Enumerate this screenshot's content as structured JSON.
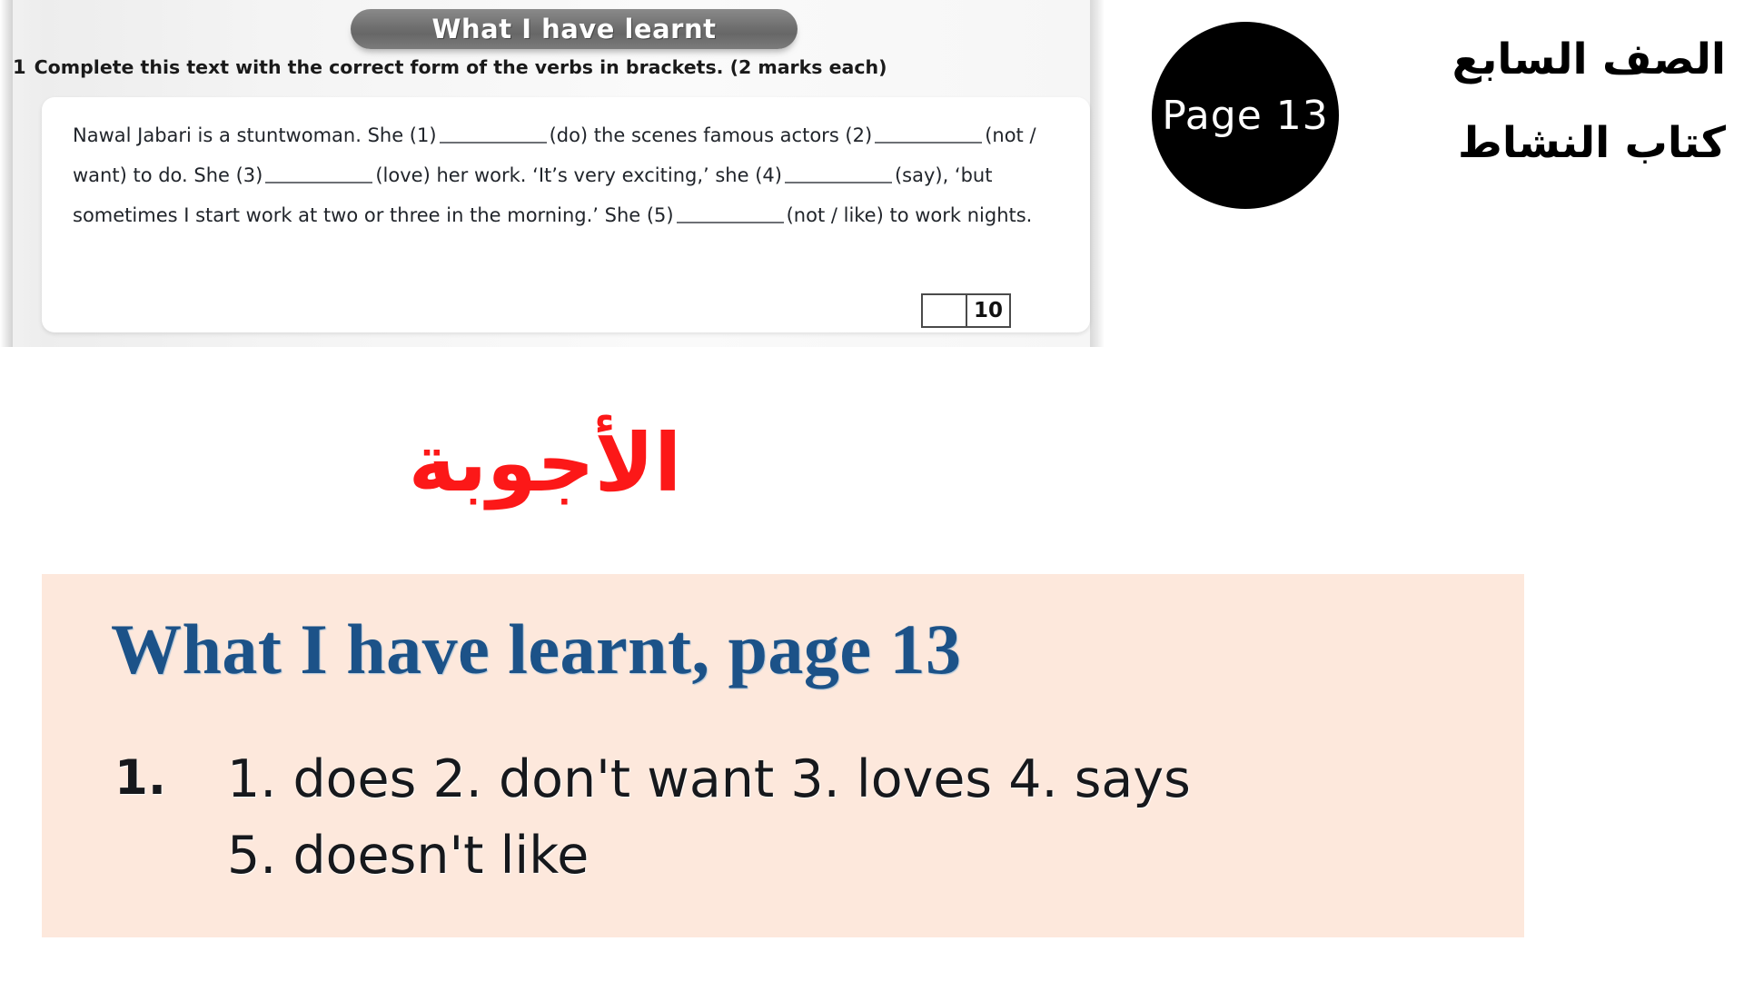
{
  "textbook": {
    "banner_label": "What I have learnt",
    "exercise_number": "1",
    "exercise_instruction": "Complete this text with the correct form of the verbs in brackets. (2 marks each)",
    "gapfill": {
      "seg1": "Nawal Jabari is a stuntwoman. She (1)",
      "seg2": "(do) the scenes famous actors (2)",
      "seg3": "(not / want) to do. She (3)",
      "seg4": "(love) her work. ‘It’s very exciting,’ she (4)",
      "seg5": "(say), ‘but sometimes I start work at two or three in the morning.’ She (5)",
      "seg6": "(not / like) to work nights."
    },
    "marks_total": "10"
  },
  "page_badge": {
    "label": "Page 13"
  },
  "arabic_header": {
    "line1": "الصف السابع",
    "line2": "كتاب النشاط"
  },
  "answers_title": {
    "label": "الأجوبة"
  },
  "answer_panel": {
    "heading": "What I have learnt, page 13",
    "item_number": "1.",
    "line1": "1. does  2. don't want  3. loves  4. says",
    "line2": "5. doesn't like"
  },
  "colors": {
    "answers_title_red": "#fc1818",
    "answer_panel_bg": "#fde8dc",
    "answer_heading_blue": "#1c5288",
    "page_badge_bg": "#000000",
    "banner_gray": "#6f6f6f"
  }
}
